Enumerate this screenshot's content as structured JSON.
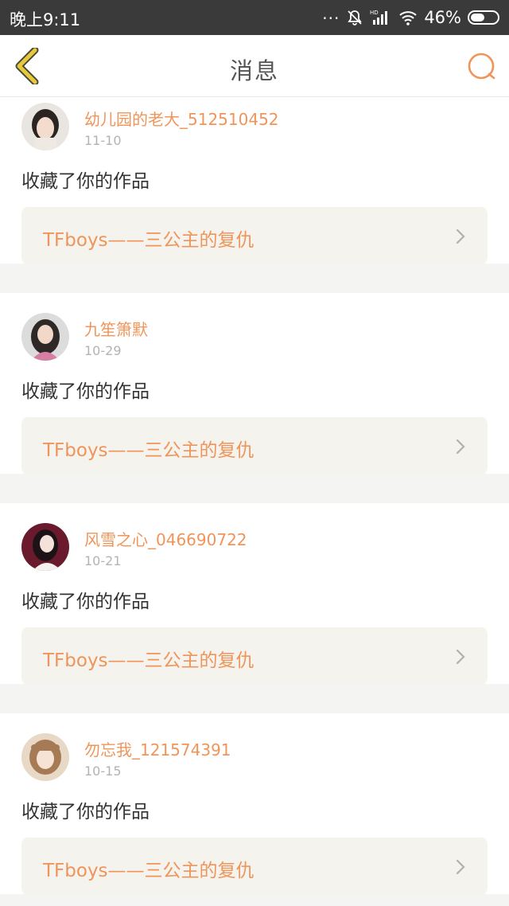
{
  "status_bar": {
    "time": "晚上9:11",
    "dots": "...",
    "battery": "46%",
    "icons": [
      "mute-bell-icon",
      "hd-signal-icon",
      "wifi-icon",
      "battery-icon"
    ]
  },
  "nav": {
    "title": "消息",
    "back_icon": "chevron-left-icon",
    "search_icon": "search-icon",
    "accent_color": "#f0955a",
    "back_color": "#e8c93a"
  },
  "messages": [
    {
      "username": "幼儿园的老大_512510452",
      "date": "11-10",
      "action": "收藏了你的作品",
      "work_title": "TFboys——三公主的复仇"
    },
    {
      "username": "九笙箫默",
      "date": "10-29",
      "action": "收藏了你的作品",
      "work_title": "TFboys——三公主的复仇"
    },
    {
      "username": "风雪之心_046690722",
      "date": "10-21",
      "action": "收藏了你的作品",
      "work_title": "TFboys——三公主的复仇"
    },
    {
      "username": "勿忘我_121574391",
      "date": "10-15",
      "action": "收藏了你的作品",
      "work_title": "TFboys——三公主的复仇"
    }
  ]
}
